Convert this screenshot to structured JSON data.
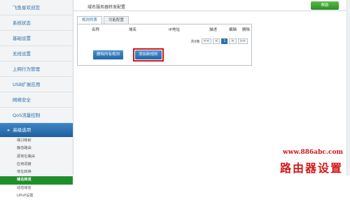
{
  "sidebar": {
    "welcome": "飞鱼星欢迎您",
    "items": [
      "系统状态",
      "基础设置",
      "无线设置",
      "上网行为管理",
      "USB扩展应用",
      "网络安全",
      "QoS流量控制"
    ],
    "section": "高级选项",
    "sub_items": [
      "端口映射",
      "静态路由",
      "源地址路由",
      "应用调度",
      "地址转换",
      "域名转发",
      "动态域名",
      "UPnP设置"
    ],
    "active_sub": 5
  },
  "content": {
    "title": "域名服务器转发配置",
    "help": "帮助",
    "tabs": [
      "规则列表",
      "功能配置"
    ],
    "columns": [
      "名称",
      "域名",
      "IP地址",
      "描述",
      "编辑",
      "删除"
    ],
    "pager": {
      "total": "共0条",
      "first": "<<",
      "prev": "<",
      "current": "1",
      "next": ">",
      "last": ">>"
    },
    "btn_delete_all": "删除所有规则",
    "btn_add": "添加新规则"
  },
  "watermark": {
    "url": "www.886abc.com",
    "text": "路由器设置"
  },
  "colors": {
    "accent_blue": "#2f6ea6",
    "active_green": "#1e8f2b",
    "highlight_red": "#d7141a"
  }
}
